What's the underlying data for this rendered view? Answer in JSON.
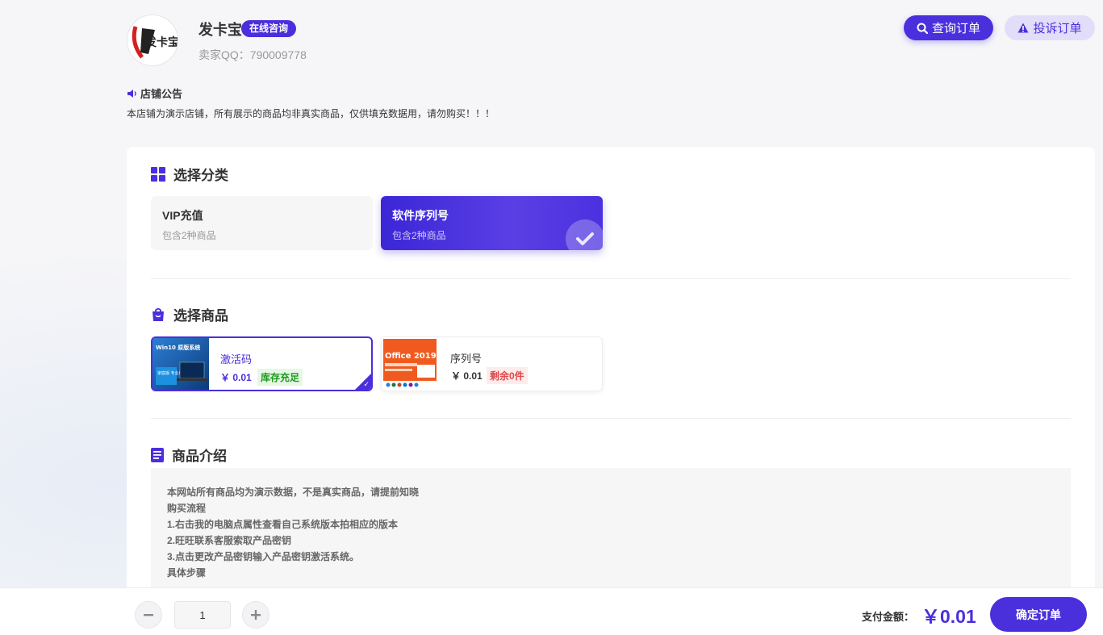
{
  "header": {
    "shop_name": "发卡宝",
    "online_badge": "在线咨询",
    "seller_qq": "卖家QQ：790009778",
    "logo_text": "发卡宝",
    "query_order": "查询订单",
    "complain_order": "投诉订单"
  },
  "notice": {
    "title": "店铺公告",
    "text": "本店铺为演示店铺，所有展示的商品均非真实商品，仅供填充数据用，请勿购买！！！"
  },
  "category_section": {
    "title": "选择分类",
    "items": [
      {
        "name": "VIP充值",
        "desc": "包含2种商品"
      },
      {
        "name": "软件序列号",
        "desc": "包含2种商品"
      }
    ]
  },
  "product_section": {
    "title": "选择商品",
    "items": [
      {
        "name": "激活码",
        "price": "￥ 0.01",
        "stock": "库存充足",
        "thumb_title": "Win10 原版系统",
        "thumb_tag": "家庭版 专业版"
      },
      {
        "name": "序列号",
        "price": "￥ 0.01",
        "stock": "剩余0件",
        "thumb_title": "Office 2019"
      }
    ]
  },
  "intro_section": {
    "title": "商品介绍",
    "lines": [
      "本网站所有商品均为演示数据，不是真实商品，请提前知晓",
      "购买流程",
      "1.右击我的电脑点属性查看自己系统版本拍相应的版本",
      "2.旺旺联系客服索取产品密钥",
      "3.点击更改产品密钥输入产品密钥激活系统。",
      "具体步骤"
    ]
  },
  "footer": {
    "quantity": "1",
    "pay_label": "支付金额：",
    "pay_amount": "￥0.01",
    "confirm": "确定订单"
  },
  "colors": {
    "accent": "#4a2fdc",
    "stock_ok": "#1e9a1e",
    "stock_none": "#e04848"
  }
}
